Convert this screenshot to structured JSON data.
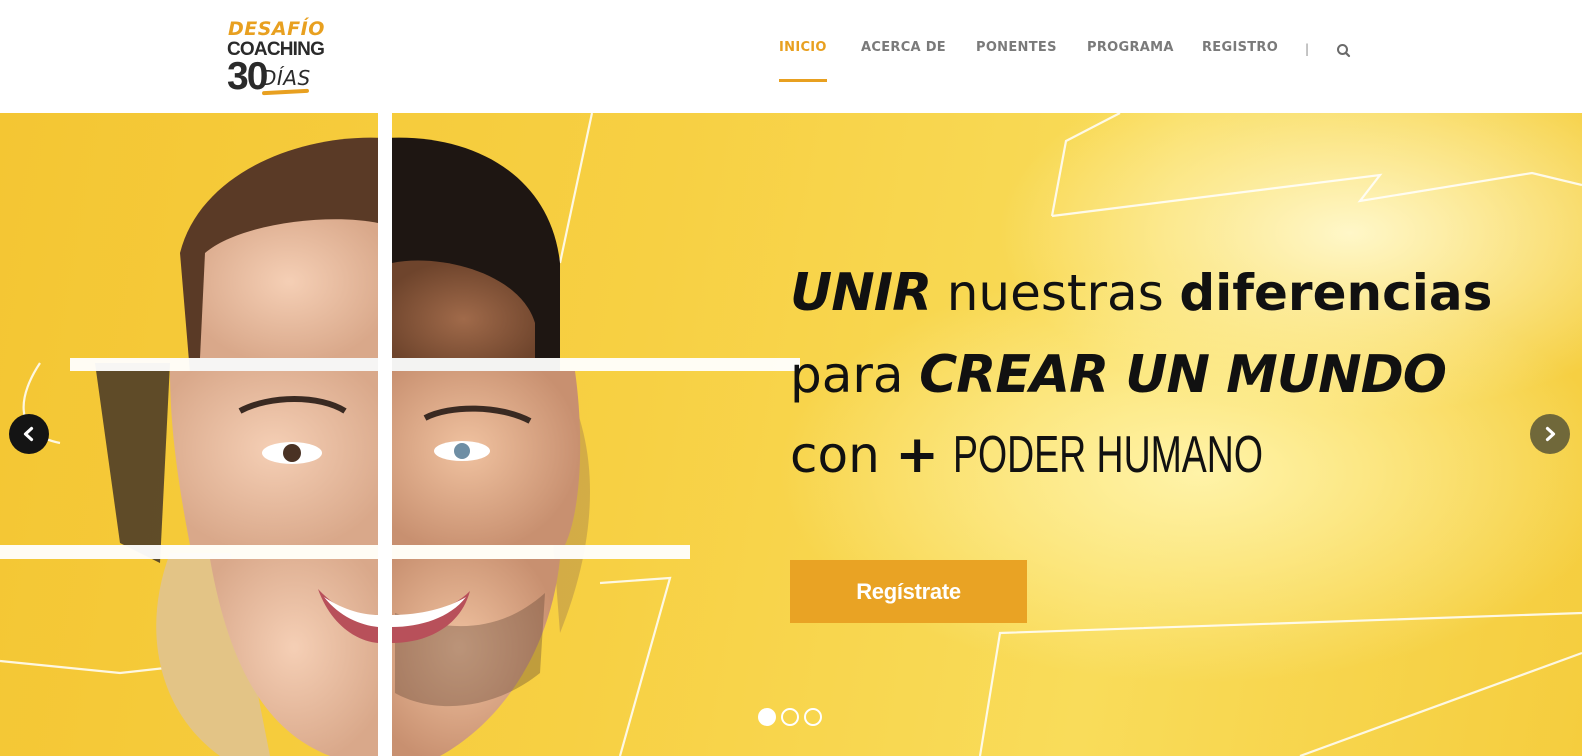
{
  "logo": {
    "line1": "DESAFÍO",
    "line2": "COACHING",
    "number": "30",
    "word": "DÍAS",
    "accent": "#e8a020"
  },
  "nav": {
    "items": [
      {
        "label": "INICIO",
        "active": true
      },
      {
        "label": "ACERCA DE",
        "active": false
      },
      {
        "label": "PONENTES",
        "active": false
      },
      {
        "label": "PROGRAMA",
        "active": false
      },
      {
        "label": "REGISTRO",
        "active": false
      }
    ],
    "separator": "|",
    "search_icon": "search-icon"
  },
  "slider": {
    "headline": {
      "line1": {
        "w1": "UNIR",
        "w2": "nuestras",
        "w3": "diferencias"
      },
      "line2": {
        "w1": "para",
        "w2": "CREAR UN MUNDO"
      },
      "line3": {
        "w1": "con",
        "w2": "+",
        "w3": "PODER HUMANO"
      }
    },
    "cta_label": "Regístrate",
    "prev_icon": "chevron-left-icon",
    "next_icon": "chevron-right-icon",
    "slides_total": 3,
    "active_slide": 1,
    "colors": {
      "background": "#f7d043",
      "button": "#e9a324"
    }
  }
}
